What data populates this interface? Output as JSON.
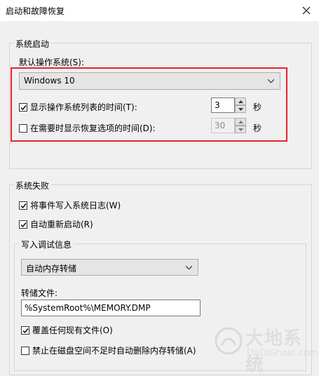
{
  "window": {
    "title": "启动和故障恢复"
  },
  "system_startup": {
    "legend": "系统启动",
    "default_os_label": "默认操作系统(S):",
    "default_os_value": "Windows 10",
    "show_os_list": {
      "label": "显示操作系统列表的时间(T):",
      "checked": true,
      "value": "3",
      "unit": "秒"
    },
    "show_recovery": {
      "label": "在需要时显示恢复选项的时间(D):",
      "checked": false,
      "value": "30",
      "unit": "秒"
    }
  },
  "system_failure": {
    "legend": "系统失败",
    "write_event_log": {
      "label": "将事件写入系统日志(W)",
      "checked": true
    },
    "auto_restart": {
      "label": "自动重新启动(R)",
      "checked": true
    },
    "debug_info": {
      "legend": "写入调试信息",
      "dump_type": "自动内存转储",
      "dump_file_label": "转储文件:",
      "dump_file_value": "%SystemRoot%\\MEMORY.DMP",
      "overwrite": {
        "label": "覆盖任何现有文件(O)",
        "checked": true
      },
      "disable_auto_delete": {
        "label": "禁止在磁盘空间不足时自动删除内存转储(A)",
        "checked": false
      }
    }
  },
  "watermark": {
    "text": "大地系统",
    "sub": "DaDiGhost.com"
  },
  "colors": {
    "highlight": "#e8232a"
  }
}
